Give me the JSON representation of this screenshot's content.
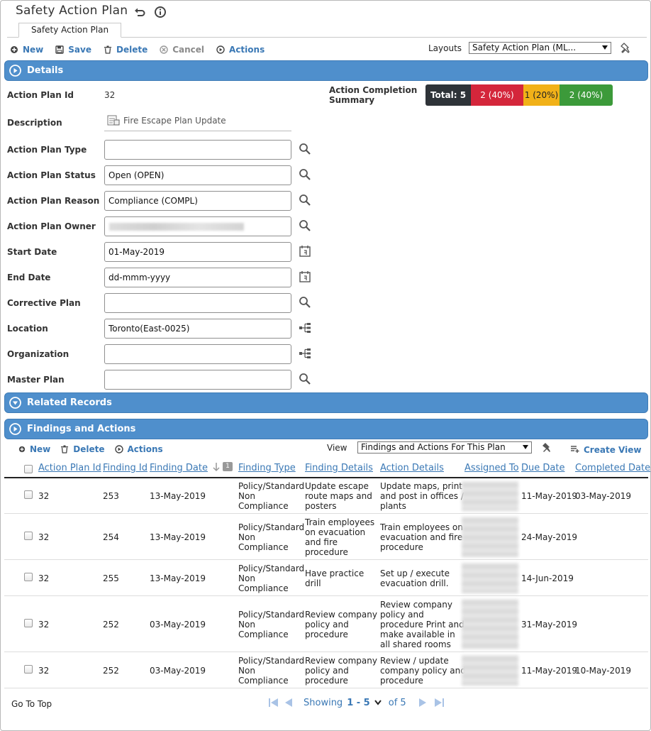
{
  "app": {
    "title": "Safety Action Plan",
    "tab_label": "Safety Action Plan"
  },
  "toolbar": {
    "new_label": "New",
    "save_label": "Save",
    "delete_label": "Delete",
    "cancel_label": "Cancel",
    "actions_label": "Actions",
    "layouts_label": "Layouts",
    "layouts_value": "Safety Action Plan (ML..."
  },
  "details": {
    "section_label": "Details",
    "action_plan_id_label": "Action Plan Id",
    "action_plan_id_value": "32",
    "description_label": "Description",
    "description_value": "Fire Escape Plan Update",
    "action_plan_type_label": "Action Plan Type",
    "action_plan_type_value": "",
    "action_plan_status_label": "Action Plan Status",
    "action_plan_status_value": "Open (OPEN)",
    "action_plan_reason_label": "Action Plan Reason",
    "action_plan_reason_value": "Compliance (COMPL)",
    "action_plan_owner_label": "Action Plan Owner",
    "start_date_label": "Start Date",
    "start_date_value": "01-May-2019",
    "end_date_label": "End Date",
    "end_date_placeholder": "dd-mmm-yyyy",
    "corrective_plan_label": "Corrective Plan",
    "corrective_plan_value": "",
    "location_label": "Location",
    "location_value": "Toronto(East-0025)",
    "organization_label": "Organization",
    "organization_value": "",
    "master_plan_label": "Master Plan",
    "master_plan_value": "",
    "summary_label_line1": "Action Completion",
    "summary_label_line2": "Summary",
    "summary_total": "Total: 5",
    "summary_red": "2 (40%)",
    "summary_yellow": "1 (20%)",
    "summary_green": "2 (40%)"
  },
  "colors": {
    "header_blue": "#4f8fcc",
    "link_blue": "#3a78b5",
    "total_dark": "#2e3338",
    "red": "#d4263b",
    "yellow": "#f1b118",
    "green": "#3c9a3a"
  },
  "related": {
    "section_label": "Related Records"
  },
  "findings": {
    "section_label": "Findings and Actions",
    "new_label": "New",
    "delete_label": "Delete",
    "actions_label": "Actions",
    "view_label": "View",
    "view_value": "Findings and Actions For This Plan",
    "create_view_label": "Create View",
    "sort_badge": "1",
    "columns": {
      "plan_id": "Action Plan Id",
      "finding_id": "Finding Id",
      "finding_date": "Finding Date",
      "finding_type": "Finding Type",
      "finding_details": "Finding Details",
      "action_details": "Action Details",
      "assigned_to": "Assigned To",
      "due_date": "Due Date",
      "completed_date": "Completed Date"
    },
    "rows": [
      {
        "plan_id": "32",
        "finding_id": "253",
        "finding_date": "13-May-2019",
        "type_l1": "Policy/Standard",
        "type_l2": "Non",
        "type_l3": "Compliance",
        "fd_l1": "Update escape",
        "fd_l2": "route maps and",
        "fd_l3": "posters",
        "fd_l4": "",
        "ad_l1": "Update maps, print",
        "ad_l2": "and post in offices /",
        "ad_l3": "plants",
        "ad_l4": "",
        "ad_l5": "",
        "due": "11-May-2019",
        "completed": "03-May-2019"
      },
      {
        "plan_id": "32",
        "finding_id": "254",
        "finding_date": "13-May-2019",
        "type_l1": "Policy/Standard",
        "type_l2": "Non",
        "type_l3": "Compliance",
        "fd_l1": "Train employees",
        "fd_l2": "on evacuation",
        "fd_l3": "and fire",
        "fd_l4": "procedure",
        "ad_l1": "Train employees on",
        "ad_l2": "evacuation and fire",
        "ad_l3": "procedure",
        "ad_l4": "",
        "ad_l5": "",
        "due": "24-May-2019",
        "completed": ""
      },
      {
        "plan_id": "32",
        "finding_id": "255",
        "finding_date": "13-May-2019",
        "type_l1": "Policy/Standard",
        "type_l2": "Non",
        "type_l3": "Compliance",
        "fd_l1": "Have practice",
        "fd_l2": "drill",
        "fd_l3": "",
        "fd_l4": "",
        "ad_l1": "Set up / execute",
        "ad_l2": "evacuation drill.",
        "ad_l3": "",
        "ad_l4": "",
        "ad_l5": "",
        "due": "14-Jun-2019",
        "completed": ""
      },
      {
        "plan_id": "32",
        "finding_id": "252",
        "finding_date": "03-May-2019",
        "type_l1": "Policy/Standard",
        "type_l2": "Non",
        "type_l3": "Compliance",
        "fd_l1": "Review company",
        "fd_l2": "policy and",
        "fd_l3": "procedure",
        "fd_l4": "",
        "ad_l1": "Review company",
        "ad_l2": "policy and",
        "ad_l3": "procedure Print and",
        "ad_l4": "make available in",
        "ad_l5": "all shared rooms",
        "due": "31-May-2019",
        "completed": ""
      },
      {
        "plan_id": "32",
        "finding_id": "252",
        "finding_date": "03-May-2019",
        "type_l1": "Policy/Standard",
        "type_l2": "Non",
        "type_l3": "Compliance",
        "fd_l1": "Review company",
        "fd_l2": "policy and",
        "fd_l3": "procedure",
        "fd_l4": "",
        "ad_l1": "Review / update",
        "ad_l2": "company policy and",
        "ad_l3": "procedure",
        "ad_l4": "",
        "ad_l5": "",
        "due": "11-May-2019",
        "completed": "10-May-2019"
      }
    ]
  },
  "footer": {
    "go_to_top": "Go To Top",
    "showing_label": "Showing",
    "range": "1 - 5",
    "of_label": "of 5"
  }
}
